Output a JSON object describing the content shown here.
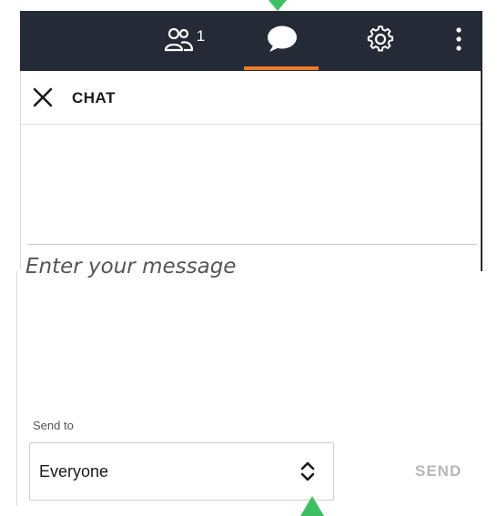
{
  "toolbar": {
    "people_count": "1",
    "people_icon": "people-icon",
    "chat_icon": "chat-bubble-icon",
    "settings_icon": "gear-icon",
    "more_icon": "more-vertical-icon",
    "active_tab": "chat",
    "active_color": "#f07a28",
    "background_color": "#242b36"
  },
  "chat_panel": {
    "close_icon": "close-icon",
    "title": "CHAT"
  },
  "composer": {
    "placeholder": "Enter your message",
    "send_to_label": "Send to",
    "send_to_value": "Everyone",
    "send_label": "SEND"
  },
  "annotation": {
    "pointer_color": "#3fbf63"
  }
}
